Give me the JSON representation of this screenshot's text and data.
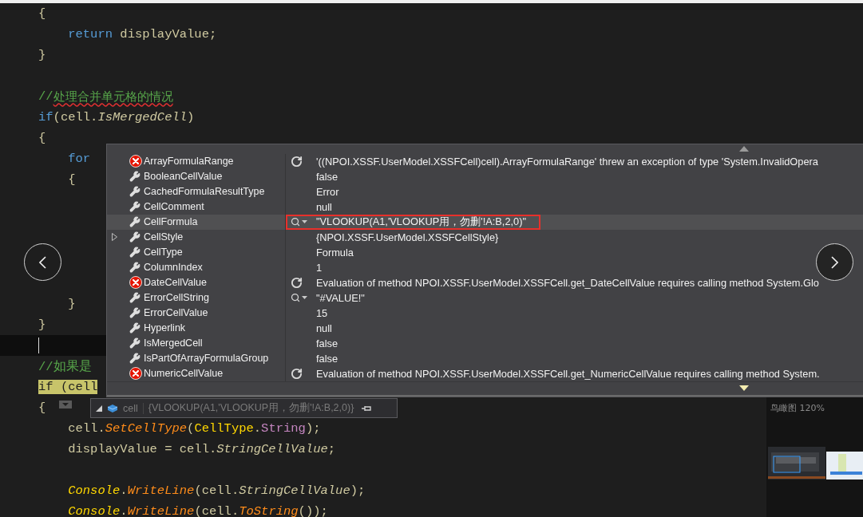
{
  "code_lines": [
    {
      "kind": "normal",
      "indented": false,
      "tokens": [
        {
          "kind": "plain",
          "text": "{"
        }
      ]
    },
    {
      "kind": "normal",
      "indented": true,
      "tokens": [
        {
          "kind": "keyword",
          "text": "return"
        },
        {
          "kind": "plain",
          "text": " displayValue;"
        }
      ]
    },
    {
      "kind": "normal",
      "indented": false,
      "tokens": [
        {
          "kind": "plain",
          "text": "}"
        }
      ]
    },
    {
      "kind": "normal"
    },
    {
      "kind": "normal",
      "indented": false,
      "tokens": [
        {
          "kind": "comment",
          "text": "//"
        },
        {
          "kind": "flagged-comment",
          "text": "处理合并单元格的情况"
        }
      ]
    },
    {
      "kind": "normal",
      "indented": false,
      "tokens": [
        {
          "kind": "keyword",
          "text": "if"
        },
        {
          "kind": "plain",
          "text": "(cell."
        },
        {
          "kind": "property",
          "text": "IsMergedCell"
        },
        {
          "kind": "plain",
          "text": ")"
        }
      ]
    },
    {
      "kind": "normal",
      "indented": false,
      "tokens": [
        {
          "kind": "plain",
          "text": "{"
        }
      ]
    },
    {
      "kind": "normal",
      "indented": true,
      "tokens": [
        {
          "kind": "keyword",
          "text": "for"
        }
      ]
    },
    {
      "kind": "normal",
      "indented": true,
      "tokens": [
        {
          "kind": "plain",
          "text": "{"
        }
      ]
    },
    {
      "kind": "normal"
    },
    {
      "kind": "normal"
    },
    {
      "kind": "normal"
    },
    {
      "kind": "normal"
    },
    {
      "kind": "normal"
    },
    {
      "kind": "normal",
      "indented": true,
      "tokens": [
        {
          "kind": "plain",
          "text": "}"
        }
      ]
    },
    {
      "kind": "normal",
      "indented": false,
      "tokens": [
        {
          "kind": "plain",
          "text": "}"
        }
      ]
    },
    {
      "kind": "caret"
    },
    {
      "kind": "normal",
      "indented": false,
      "tokens": [
        {
          "kind": "comment",
          "text": "//如果是"
        }
      ]
    },
    {
      "kind": "statement",
      "indented": false,
      "tokens": [
        {
          "kind": "keyword",
          "text": "if (cell"
        }
      ]
    },
    {
      "kind": "normal",
      "indented": false,
      "tokens": [
        {
          "kind": "plain",
          "text": "{"
        }
      ]
    },
    {
      "kind": "normal",
      "indented": true,
      "tokens": [
        {
          "kind": "plain",
          "text": "cell."
        },
        {
          "kind": "method",
          "text": "SetCellType"
        },
        {
          "kind": "plain",
          "text": "("
        },
        {
          "kind": "type",
          "text": "CellType"
        },
        {
          "kind": "plain",
          "text": "."
        },
        {
          "kind": "enum",
          "text": "String"
        },
        {
          "kind": "plain",
          "text": ");"
        }
      ]
    },
    {
      "kind": "normal",
      "indented": true,
      "tokens": [
        {
          "kind": "plain",
          "text": "displayValue = cell."
        },
        {
          "kind": "property",
          "text": "StringCellValue"
        },
        {
          "kind": "plain",
          "text": ";"
        }
      ]
    },
    {
      "kind": "normal"
    },
    {
      "kind": "normal",
      "indented": true,
      "tokens": [
        {
          "kind": "static-class",
          "text": "Console"
        },
        {
          "kind": "plain",
          "text": "."
        },
        {
          "kind": "method",
          "text": "WriteLine"
        },
        {
          "kind": "plain",
          "text": "(cell."
        },
        {
          "kind": "property",
          "text": "StringCellValue"
        },
        {
          "kind": "plain",
          "text": ");"
        }
      ]
    },
    {
      "kind": "normal",
      "indented": true,
      "tokens": [
        {
          "kind": "static-class",
          "text": "Console"
        },
        {
          "kind": "plain",
          "text": "."
        },
        {
          "kind": "method",
          "text": "WriteLine"
        },
        {
          "kind": "plain",
          "text": "(cell."
        },
        {
          "kind": "method",
          "text": "ToString"
        },
        {
          "kind": "plain",
          "text": "());"
        }
      ]
    }
  ],
  "debug_popup": {
    "rows": [
      {
        "name": "ArrayFormulaRange",
        "kind": "error",
        "expandable": false,
        "value": "'((NPOI.XSSF.UserModel.XSSFCell)cell).ArrayFormulaRange' threw an exception of type 'System.InvalidOpera",
        "selected": false,
        "outlined": false
      },
      {
        "name": "BooleanCellValue",
        "kind": "property",
        "expandable": false,
        "value": "false",
        "selected": false,
        "outlined": false
      },
      {
        "name": "CachedFormulaResultType",
        "kind": "property",
        "expandable": false,
        "value": "Error",
        "selected": false,
        "outlined": false
      },
      {
        "name": "CellComment",
        "kind": "property",
        "expandable": false,
        "value": "null",
        "selected": false,
        "outlined": false
      },
      {
        "name": "CellFormula",
        "kind": "string",
        "expandable": false,
        "value": "\"VLOOKUP(A1,'VLOOKUP用，勿删'!A:B,2,0)\"",
        "selected": true,
        "outlined": true
      },
      {
        "name": "CellStyle",
        "kind": "property",
        "expandable": true,
        "value": "{NPOI.XSSF.UserModel.XSSFCellStyle}",
        "selected": false,
        "outlined": false
      },
      {
        "name": "CellType",
        "kind": "property",
        "expandable": false,
        "value": "Formula",
        "selected": false,
        "outlined": false
      },
      {
        "name": "ColumnIndex",
        "kind": "property",
        "expandable": false,
        "value": "1",
        "selected": false,
        "outlined": false
      },
      {
        "name": "DateCellValue",
        "kind": "error",
        "expandable": false,
        "value": "Evaluation of method NPOI.XSSF.UserModel.XSSFCell.get_DateCellValue requires calling method System.Glo",
        "selected": false,
        "outlined": false
      },
      {
        "name": "ErrorCellString",
        "kind": "string",
        "expandable": false,
        "value": "\"#VALUE!\"",
        "selected": false,
        "outlined": false
      },
      {
        "name": "ErrorCellValue",
        "kind": "property",
        "expandable": false,
        "value": "15",
        "selected": false,
        "outlined": false
      },
      {
        "name": "Hyperlink",
        "kind": "property",
        "expandable": false,
        "value": "null",
        "selected": false,
        "outlined": false
      },
      {
        "name": "IsMergedCell",
        "kind": "property",
        "expandable": false,
        "value": "false",
        "selected": false,
        "outlined": false
      },
      {
        "name": "IsPartOfArrayFormulaGroup",
        "kind": "property",
        "expandable": false,
        "value": "false",
        "selected": false,
        "outlined": false
      },
      {
        "name": "NumericCellValue",
        "kind": "error",
        "expandable": false,
        "value": "Evaluation of method NPOI.XSSF.UserModel.XSSFCell.get_NumericCellValue requires calling method System.",
        "selected": false,
        "outlined": false
      }
    ]
  },
  "datatip": {
    "name": "cell",
    "value": "{VLOOKUP(A1,'VLOOKUP用，勿删'!A:B,2,0)}"
  },
  "birds_eye": {
    "title": "鸟瞰图 120%"
  }
}
